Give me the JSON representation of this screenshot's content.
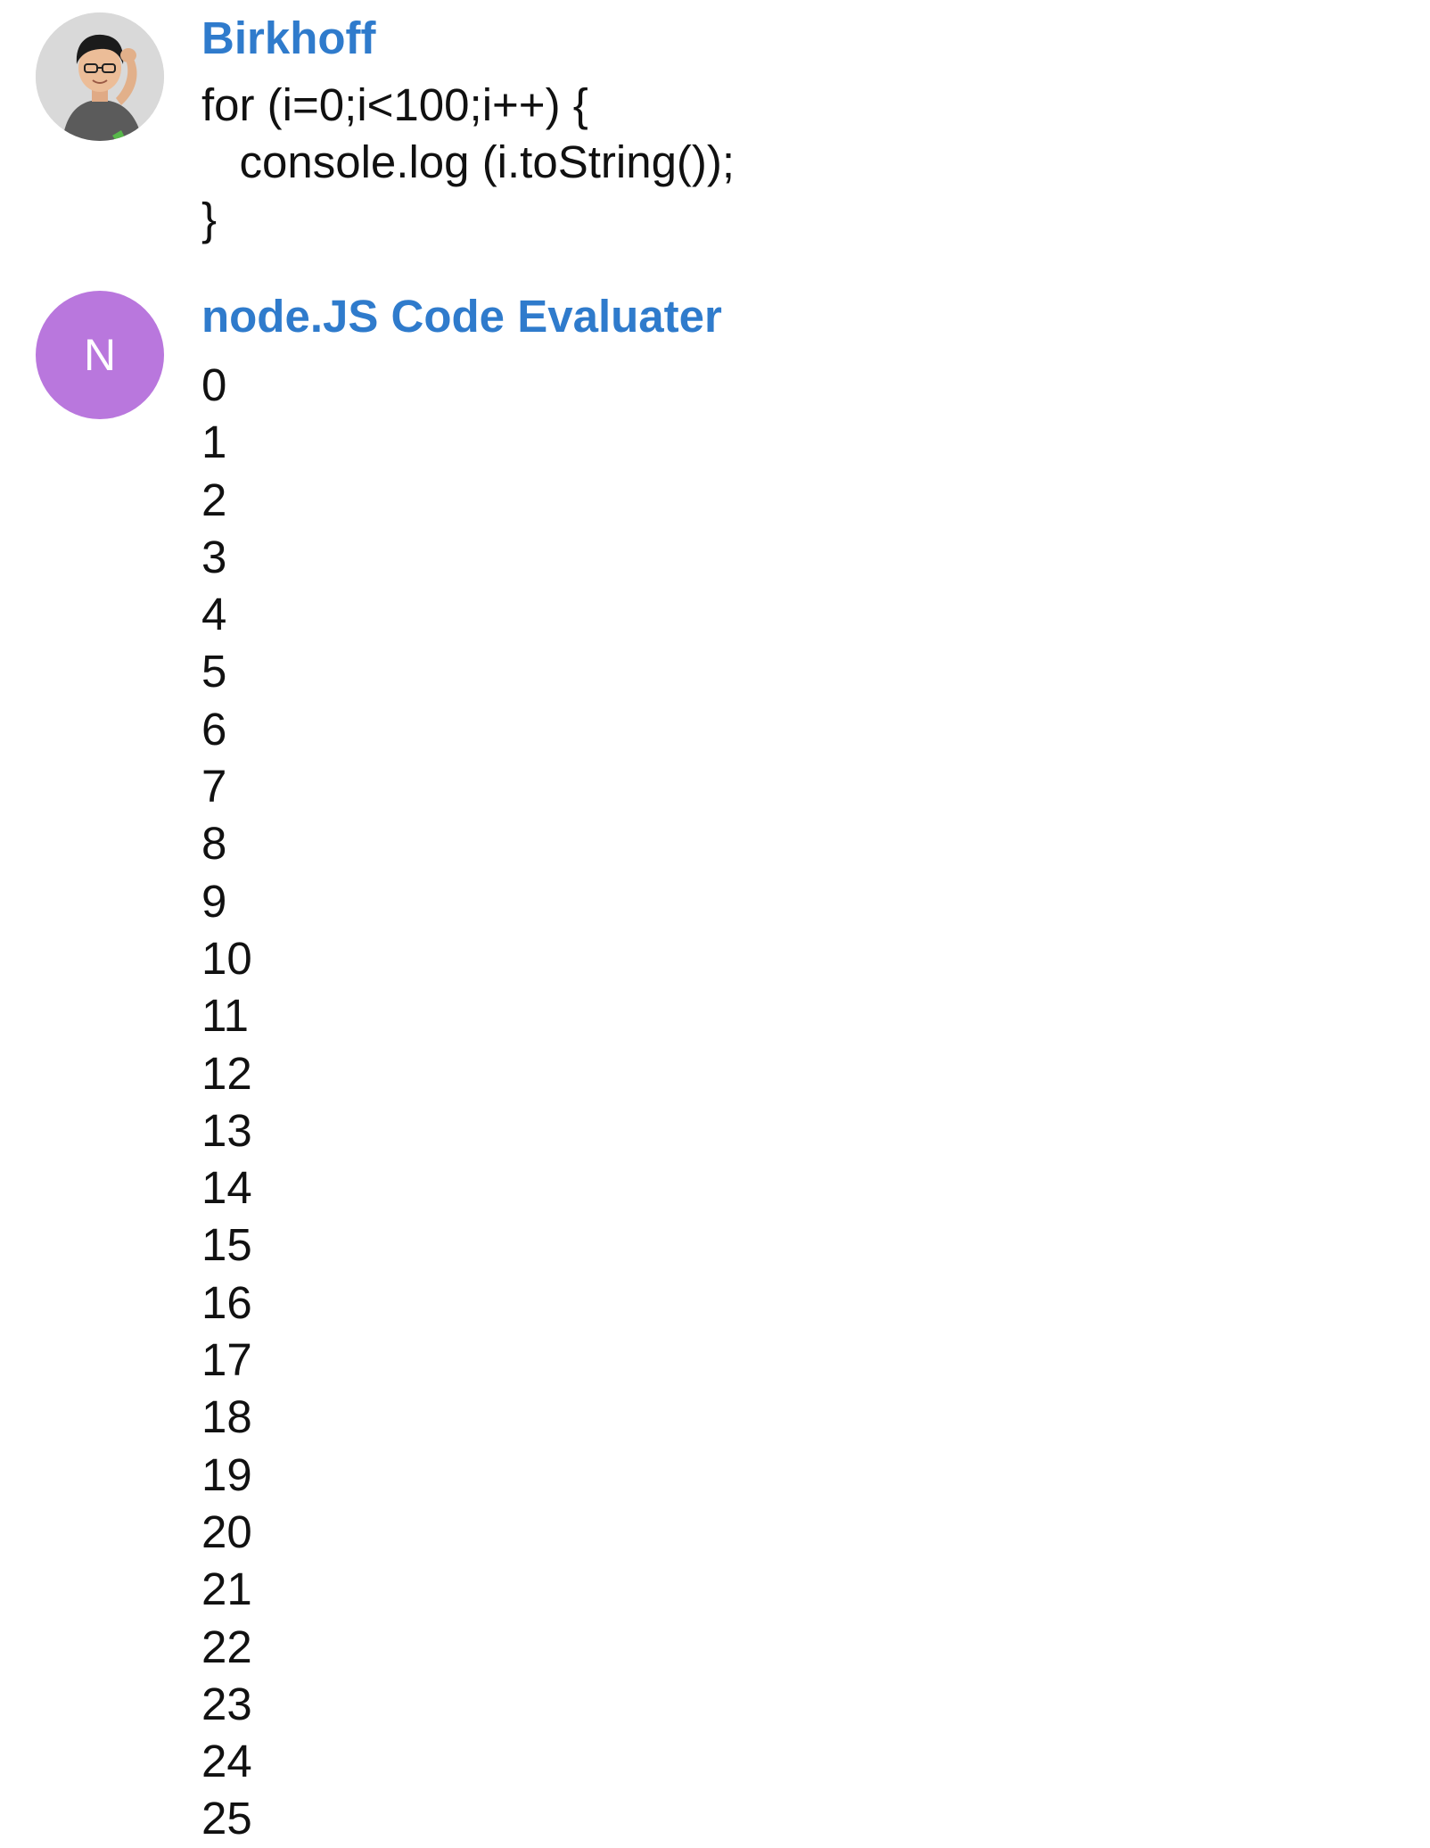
{
  "messages": [
    {
      "sender": "Birkhoff",
      "avatar": {
        "type": "photo",
        "icon": "user-photo-avatar"
      },
      "code": "for (i=0;i<100;i++) {\n   console.log (i.toString());\n}"
    },
    {
      "sender": "node.JS Code Evaluater",
      "avatar": {
        "type": "initial",
        "initial": "N",
        "color": "#b977dd"
      },
      "output_lines": [
        "0",
        "1",
        "2",
        "3",
        "4",
        "5",
        "6",
        "7",
        "8",
        "9",
        "10",
        "11",
        "12",
        "13",
        "14",
        "15",
        "16",
        "17",
        "18",
        "19",
        "20",
        "21",
        "22",
        "23",
        "24",
        "25"
      ]
    }
  ],
  "colors": {
    "sender_name": "#2f7bcc",
    "avatar_n_background": "#b977dd",
    "text": "#111111",
    "background": "#ffffff"
  }
}
